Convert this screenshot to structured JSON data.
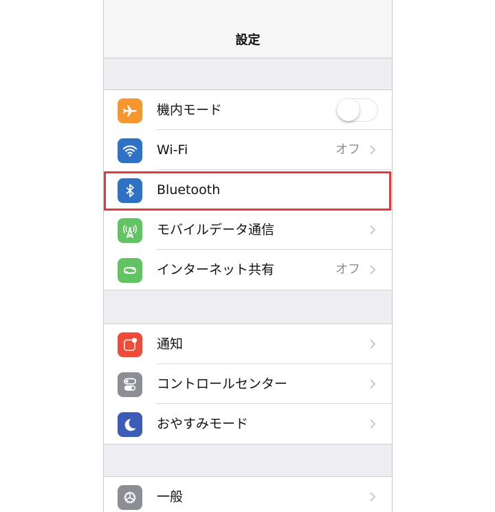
{
  "navbar": {
    "title": "設定"
  },
  "groups": [
    {
      "rows": [
        {
          "label": "機内モード",
          "icon": "airplane-icon",
          "icon_color": "#f7952f",
          "accessory": "toggle",
          "toggle_on": false
        },
        {
          "label": "Wi-Fi",
          "icon": "wifi-icon",
          "icon_color": "#2f72c5",
          "value": "オフ",
          "accessory": "chevron"
        },
        {
          "label": "Bluetooth",
          "icon": "bluetooth-icon",
          "icon_color": "#2f72c5",
          "accessory": "none"
        },
        {
          "label": "モバイルデータ通信",
          "icon": "cellular-antenna-icon",
          "icon_color": "#62c363",
          "accessory": "chevron"
        },
        {
          "label": "インターネット共有",
          "icon": "personal-hotspot-icon",
          "icon_color": "#62c363",
          "value": "オフ",
          "accessory": "chevron"
        }
      ]
    },
    {
      "rows": [
        {
          "label": "通知",
          "icon": "notifications-icon",
          "icon_color": "#ef4b38",
          "accessory": "chevron"
        },
        {
          "label": "コントロールセンター",
          "icon": "control-center-icon",
          "icon_color": "#8b8e94",
          "accessory": "chevron"
        },
        {
          "label": "おやすみモード",
          "icon": "moon-icon",
          "icon_color": "#3d5cb8",
          "accessory": "chevron"
        }
      ]
    },
    {
      "rows": [
        {
          "label": "一般",
          "icon": "gear-icon",
          "icon_color": "#8b8e94",
          "accessory": "chevron"
        }
      ]
    }
  ],
  "highlight": {
    "target": "Bluetooth",
    "color": "#e8363c"
  }
}
